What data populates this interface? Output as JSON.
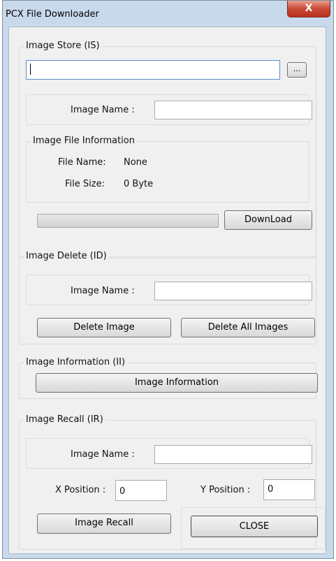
{
  "window": {
    "title": "PCX File Downloader",
    "close_glyph": "X"
  },
  "image_store": {
    "group_title": "Image Store (IS)",
    "path_value": "",
    "browse_label": "...",
    "image_name_label": "Image Name :",
    "image_name_value": "",
    "file_info": {
      "group_title": "Image File Information",
      "file_name_label": "File Name:",
      "file_name_value": "None",
      "file_size_label": "File Size:",
      "file_size_value": "0 Byte"
    },
    "progress": 0,
    "download_label": "DownLoad"
  },
  "image_delete": {
    "group_title": "Image Delete (ID)",
    "image_name_label": "Image Name :",
    "image_name_value": "",
    "delete_image_label": "Delete Image",
    "delete_all_label": "Delete All Images"
  },
  "image_information": {
    "group_title": "Image Information (II)",
    "button_label": "Image Information"
  },
  "image_recall": {
    "group_title": "Image Recall (IR)",
    "image_name_label": "Image Name :",
    "image_name_value": "",
    "x_label": "X Position :",
    "x_value": "0",
    "y_label": "Y Position :",
    "y_value": "0",
    "recall_label": "Image Recall"
  },
  "close_label": "CLOSE"
}
